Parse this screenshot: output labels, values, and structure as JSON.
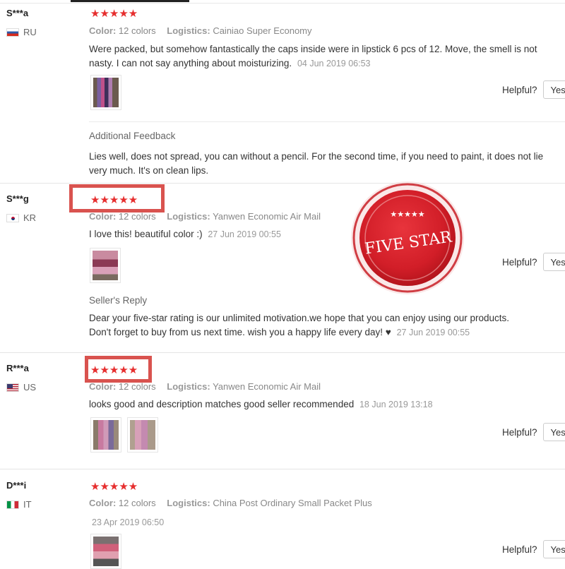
{
  "reviews": [
    {
      "user": "S***a",
      "country": "RU",
      "stars": "★★★★★",
      "color_label": "Color:",
      "color_value": "12 colors",
      "logistics_label": "Logistics:",
      "logistics_value": "Cainiao Super Economy",
      "text": "Were packed, but somehow fantastically the caps inside were in lipstick 6 pcs of 12. Move, the smell is not nasty. I can not say anything about moisturizing.",
      "date": "04 Jun 2019 06:53",
      "helpful_label": "Helpful?",
      "yes_label": "Yes (",
      "extra_heading": "Additional Feedback",
      "extra_text": "Lies well, does not spread, you can without a pencil. For the second time, if you need to paint, it does not lie very much. It's on clean lips."
    },
    {
      "user": "S***g",
      "country": "KR",
      "stars": "★★★★★",
      "color_label": "Color:",
      "color_value": "12 colors",
      "logistics_label": "Logistics:",
      "logistics_value": "Yanwen Economic Air Mail",
      "text": "I love this! beautiful color :)",
      "date": "27 Jun 2019 00:55",
      "helpful_label": "Helpful?",
      "yes_label": "Yes (",
      "extra_heading": "Seller's Reply",
      "extra_text": "Dear your five-star rating is our unlimited motivation.we hope that you can enjoy using our products. Don't forget to buy from us next time. wish you a happy life every day! ♥",
      "extra_date": "27 Jun 2019 00:55"
    },
    {
      "user": "R***a",
      "country": "US",
      "stars": "★★★★★",
      "color_label": "Color:",
      "color_value": "12 colors",
      "logistics_label": "Logistics:",
      "logistics_value": "Yanwen Economic Air Mail",
      "text": "looks good and description matches good seller recommended",
      "date": "18 Jun 2019 13:18",
      "helpful_label": "Helpful?",
      "yes_label": "Yes ("
    },
    {
      "user": "D***i",
      "country": "IT",
      "stars": "★★★★★",
      "color_label": "Color:",
      "color_value": "12 colors",
      "logistics_label": "Logistics:",
      "logistics_value": "China Post Ordinary Small Packet Plus",
      "date": "23 Apr 2019 06:50",
      "helpful_label": "Helpful?",
      "yes_label": "Yes ("
    }
  ],
  "seal": {
    "text": "FIVE STAR",
    "stars": "★★★★★",
    "color": "#d8202a"
  },
  "highlight_color": "#d9534f",
  "star_color": "#e62e2e"
}
